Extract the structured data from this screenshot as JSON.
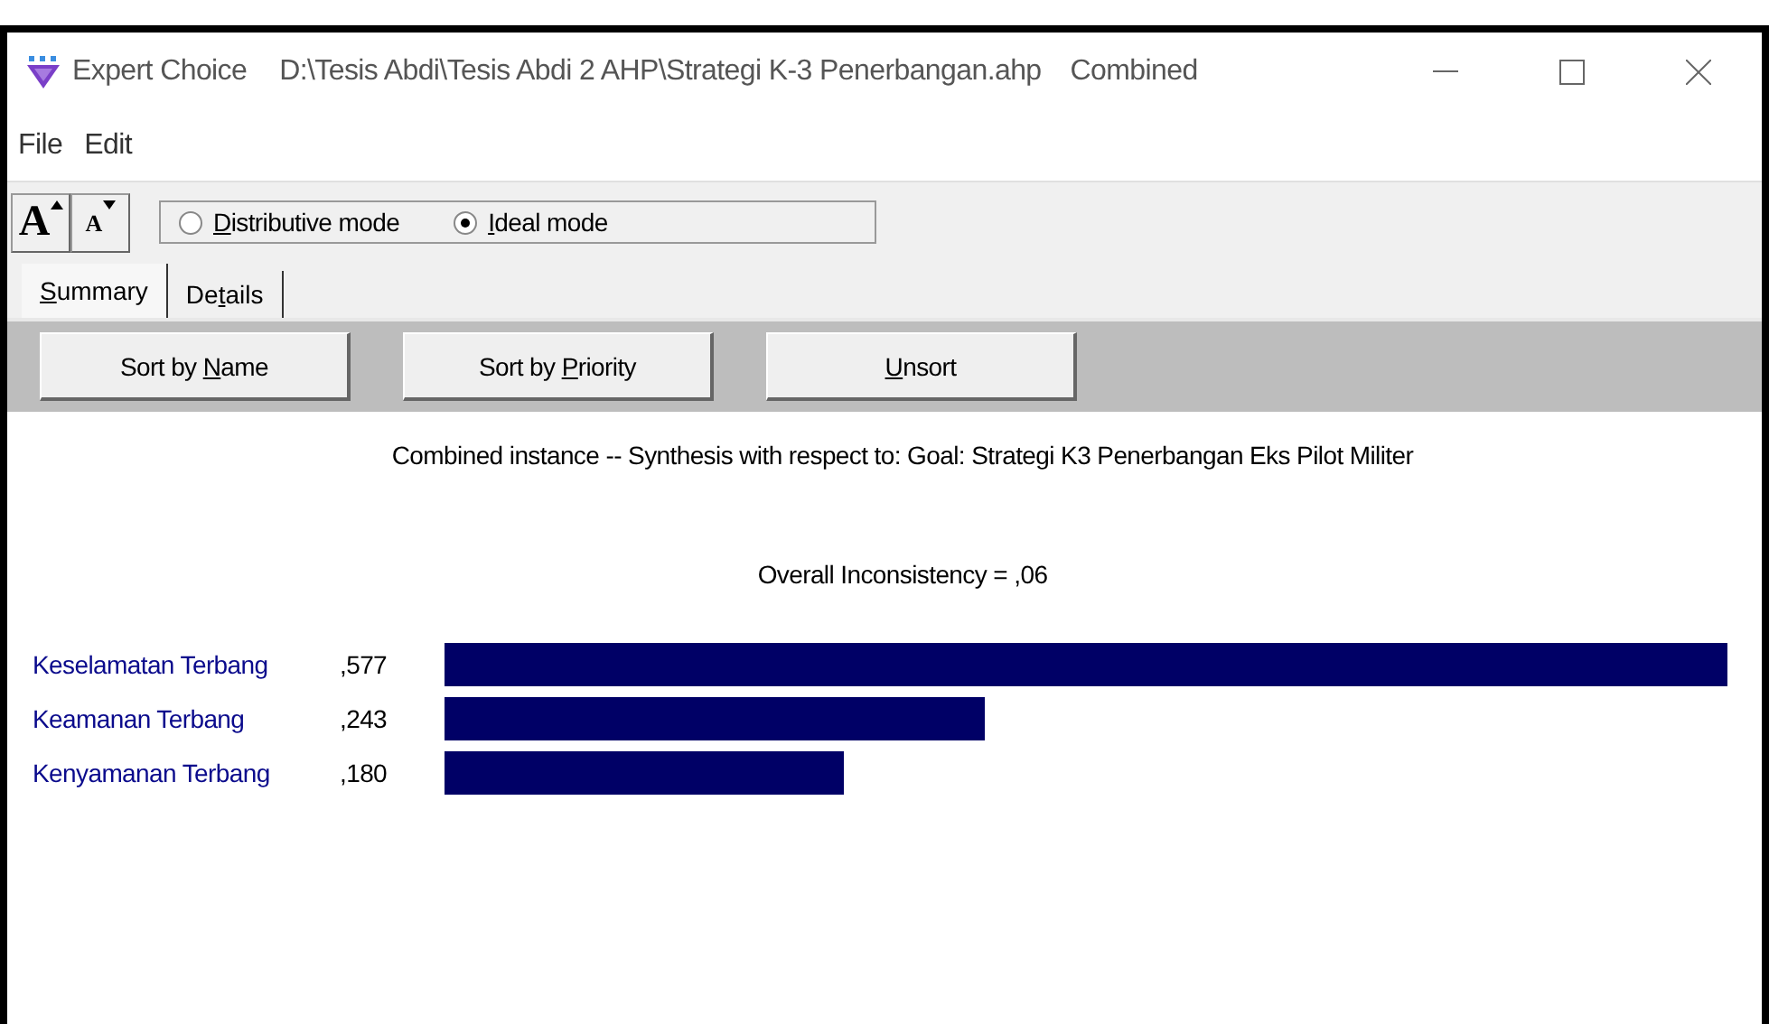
{
  "window": {
    "title": "Expert Choice",
    "path": "D:\\Tesis Abdi\\Tesis Abdi 2 AHP\\Strategi K-3 Penerbangan.ahp",
    "mode_label": "Combined"
  },
  "menu": [
    "File",
    "Edit"
  ],
  "font_buttons": [
    {
      "label": "A",
      "kind": "larger"
    },
    {
      "label": "A",
      "kind": "smaller"
    }
  ],
  "modes": [
    {
      "label_parts": [
        {
          "text": "D",
          "underlined": true
        },
        {
          "text": "istributive mode",
          "underlined": false
        }
      ],
      "selected": false
    },
    {
      "label_parts": [
        {
          "text": "I",
          "underlined": true
        },
        {
          "text": "deal mode",
          "underlined": false
        }
      ],
      "selected": true
    }
  ],
  "tabs": [
    {
      "label_parts": [
        {
          "text": "S",
          "underlined": true
        },
        {
          "text": "ummary",
          "underlined": false
        }
      ],
      "selected": true
    },
    {
      "label_parts": [
        {
          "text": "De",
          "underlined": false
        },
        {
          "text": "t",
          "underlined": true
        },
        {
          "text": "ails",
          "underlined": false
        }
      ],
      "selected": false
    }
  ],
  "sort_buttons": [
    {
      "label_parts": [
        {
          "text": "Sort by ",
          "underlined": false
        },
        {
          "text": "N",
          "underlined": true
        },
        {
          "text": "ame",
          "underlined": false
        }
      ]
    },
    {
      "label_parts": [
        {
          "text": "Sort by ",
          "underlined": false
        },
        {
          "text": "P",
          "underlined": true
        },
        {
          "text": "riority",
          "underlined": false
        }
      ]
    },
    {
      "label_parts": [
        {
          "text": "U",
          "underlined": true
        },
        {
          "text": "nsort",
          "underlined": false
        }
      ]
    }
  ],
  "heading": "Combined instance -- Synthesis with respect to: Goal: Strategi K3 Penerbangan Eks Pilot Militer",
  "inconsistency": "Overall Inconsistency = ,06",
  "results": [
    {
      "name": "Keselamatan Terbang",
      "value": ",577"
    },
    {
      "name": "Keamanan Terbang",
      "value": ",243"
    },
    {
      "name": "Kenyamanan Terbang",
      "value": ",180"
    }
  ]
}
